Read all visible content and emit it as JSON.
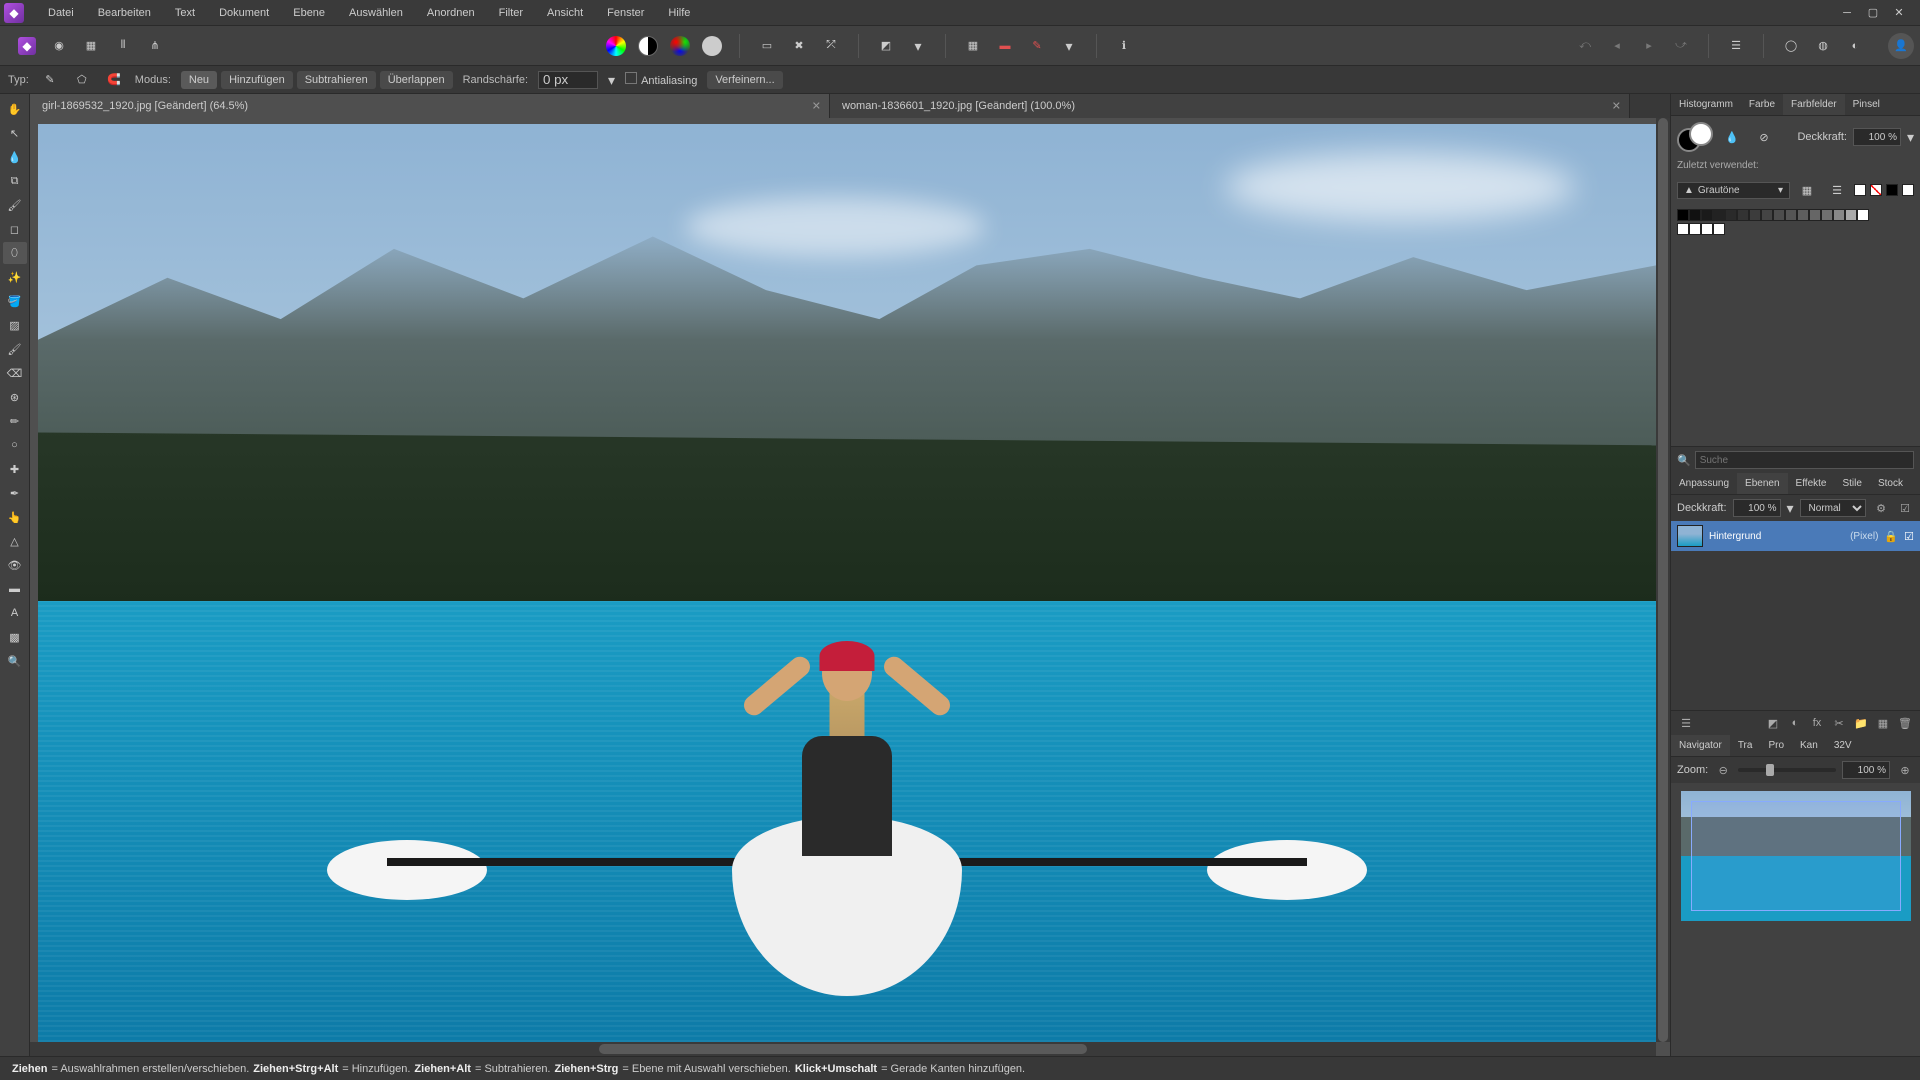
{
  "menu": [
    "Datei",
    "Bearbeiten",
    "Text",
    "Dokument",
    "Ebene",
    "Auswählen",
    "Anordnen",
    "Filter",
    "Ansicht",
    "Fenster",
    "Hilfe"
  ],
  "contextbar": {
    "type_label": "Typ:",
    "mode_label": "Modus:",
    "modes": [
      "Neu",
      "Hinzufügen",
      "Subtrahieren",
      "Überlappen"
    ],
    "feather_label": "Randschärfe:",
    "feather_value": "0 px",
    "antialias_label": "Antialiasing",
    "refine_label": "Verfeinern..."
  },
  "tabs": [
    {
      "label": "girl-1869532_1920.jpg [Geändert] (64.5%)",
      "active": true
    },
    {
      "label": "woman-1836601_1920.jpg [Geändert] (100.0%)",
      "active": false
    }
  ],
  "right_tabs_top": [
    "Histogramm",
    "Farbe",
    "Farbfelder",
    "Pinsel"
  ],
  "right_tabs_top_active": 2,
  "swatches": {
    "opacity_label": "Deckkraft:",
    "opacity_value": "100 %",
    "recent_label": "Zuletzt verwendet:",
    "palette_name": "Grautöne",
    "search_placeholder": "Suche",
    "gray_row": [
      "#000000",
      "#111111",
      "#1a1a1a",
      "#222222",
      "#2a2a2a",
      "#333333",
      "#3c3c3c",
      "#444444",
      "#4d4d4d",
      "#555555",
      "#5e5e5e",
      "#666666",
      "#707070",
      "#888888",
      "#aaaaaa",
      "#ffffff"
    ],
    "white_row": [
      "#ffffff",
      "#ffffff",
      "#ffffff",
      "#ffffff"
    ]
  },
  "mid_tabs": [
    "Anpassung",
    "Ebenen",
    "Effekte",
    "Stile",
    "Stock"
  ],
  "mid_tabs_active": 1,
  "layers": {
    "opacity_label": "Deckkraft:",
    "opacity_value": "100 %",
    "blend_mode": "Normal",
    "items": [
      {
        "name": "Hintergrund",
        "type": "(Pixel)"
      }
    ]
  },
  "nav_tabs": [
    "Navigator",
    "Tra",
    "Pro",
    "Kan",
    "32V"
  ],
  "nav_tabs_active": 0,
  "navigator": {
    "zoom_label": "Zoom:",
    "zoom_value": "100 %"
  },
  "status": {
    "s1b": "Ziehen",
    "s1": " = Auswahlrahmen erstellen/verschieben. ",
    "s2b": "Ziehen+Strg+Alt",
    "s2": " = Hinzufügen. ",
    "s3b": "Ziehen+Alt",
    "s3": " = Subtrahieren. ",
    "s4b": "Ziehen+Strg",
    "s4": " = Ebene mit Auswahl verschieben. ",
    "s5b": "Klick+Umschalt",
    "s5": " = Gerade Kanten hinzufügen."
  }
}
